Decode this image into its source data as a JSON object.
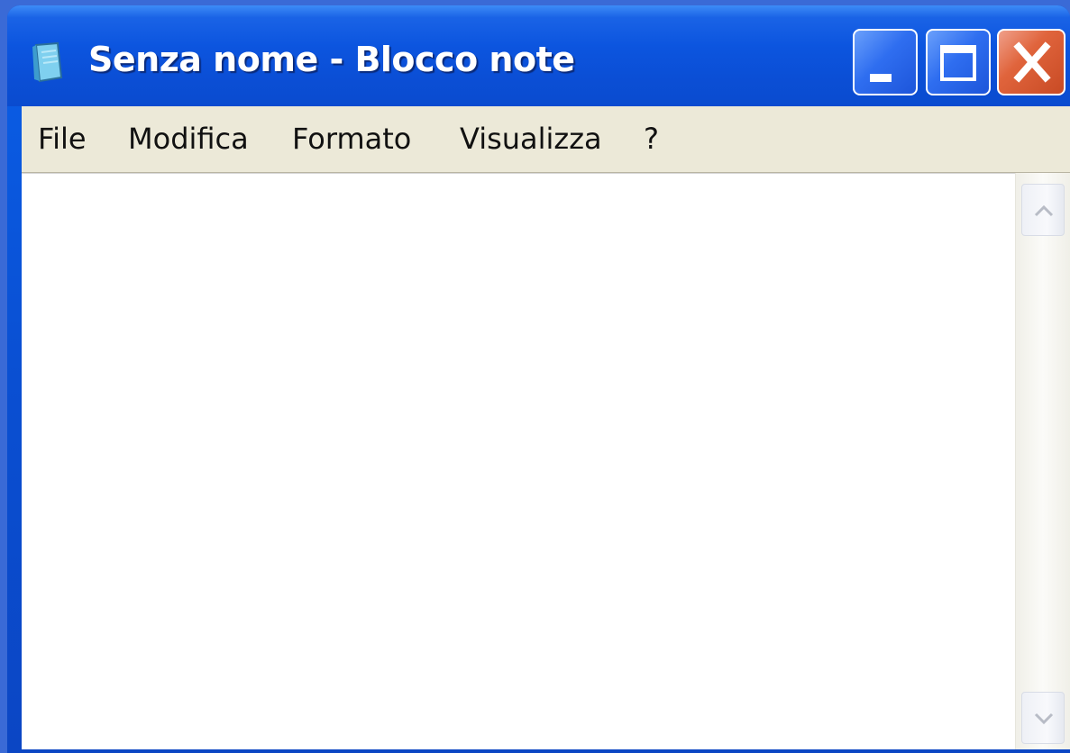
{
  "window": {
    "title": "Senza nome - Blocco note",
    "icons": {
      "app": "notepad-icon",
      "minimize": "minimize-icon",
      "maximize": "maximize-icon",
      "close": "close-icon",
      "scroll_up": "chevron-up-icon",
      "scroll_down": "chevron-down-icon"
    },
    "colors": {
      "titlebar": "#0b4fd6",
      "close_button": "#e0643c",
      "menubar": "#ece9d8",
      "editor": "#ffffff"
    }
  },
  "menubar": {
    "items": [
      {
        "label": "File"
      },
      {
        "label": "Modifica"
      },
      {
        "label": "Formato"
      },
      {
        "label": "Visualizza"
      },
      {
        "label": "?"
      }
    ]
  },
  "editor": {
    "content": ""
  }
}
